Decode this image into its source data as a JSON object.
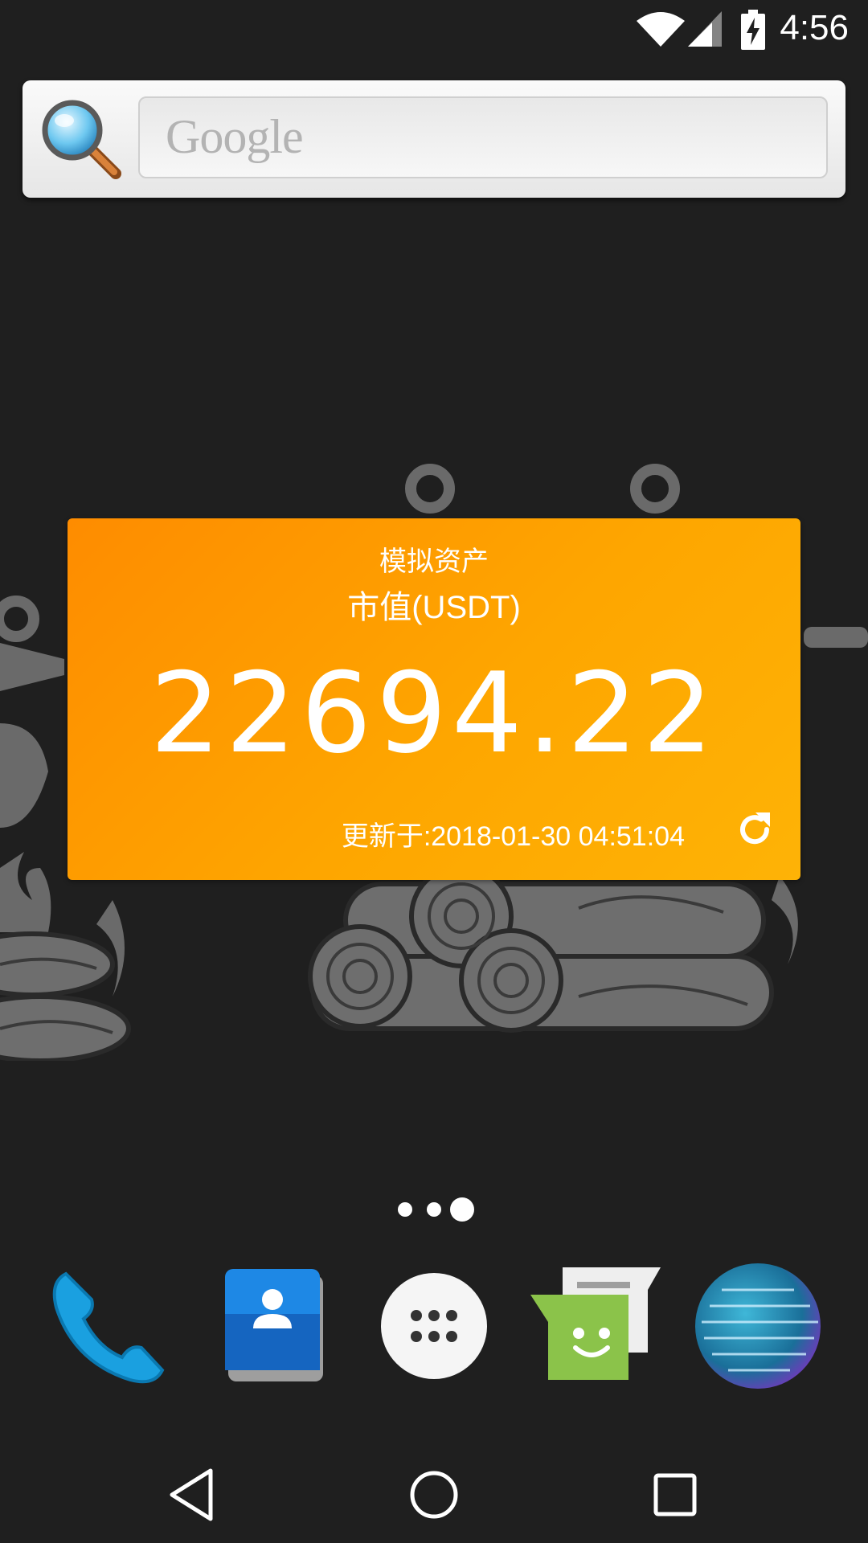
{
  "status_bar": {
    "time": "4:56",
    "icons": [
      "wifi-icon",
      "cell-signal-icon",
      "battery-charging-icon"
    ]
  },
  "search_widget": {
    "placeholder": "Google",
    "icon": "search-icon"
  },
  "asset_widget": {
    "title": "模拟资产",
    "subtitle": "市值(USDT)",
    "value": "22694.22",
    "updated": "更新于:2018-01-30 04:51:04",
    "refresh_icon": "refresh-icon",
    "colors": {
      "gradient_start": "#fe8c00",
      "gradient_end": "#feb306"
    }
  },
  "page_indicator": {
    "pages": 3,
    "current": 3
  },
  "dock": {
    "apps": [
      {
        "name": "phone",
        "icon": "phone-icon"
      },
      {
        "name": "contacts",
        "icon": "contacts-icon"
      },
      {
        "name": "app-drawer",
        "icon": "app-drawer-icon"
      },
      {
        "name": "messaging",
        "icon": "messaging-icon"
      },
      {
        "name": "browser",
        "icon": "globe-icon"
      }
    ]
  },
  "nav_bar": {
    "buttons": [
      "back-icon",
      "home-icon",
      "recents-icon"
    ]
  }
}
